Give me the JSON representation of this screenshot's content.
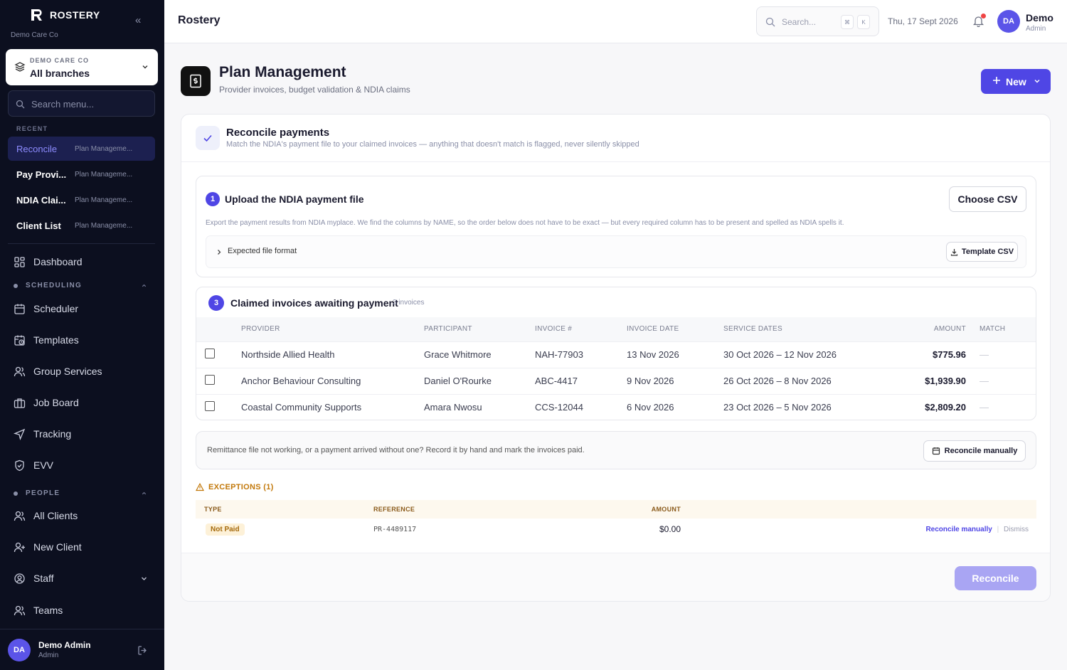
{
  "sidebar": {
    "brand": "ROSTERY",
    "org": "Demo Care Co",
    "branch_small": "DEMO CARE CO",
    "branch_big": "All branches",
    "search_placeholder": "Search menu...",
    "recent_label": "RECENT",
    "recent": [
      {
        "title": "Reconcile",
        "sub": "Plan Manageme..."
      },
      {
        "title": "Pay Provi...",
        "sub": "Plan Manageme..."
      },
      {
        "title": "NDIA Clai...",
        "sub": "Plan Manageme..."
      },
      {
        "title": "Client List",
        "sub": "Plan Manageme..."
      }
    ],
    "dashboard": "Dashboard",
    "scheduling_label": "SCHEDULING",
    "scheduling": [
      "Scheduler",
      "Templates",
      "Group Services",
      "Job Board",
      "Tracking",
      "EVV"
    ],
    "people_label": "PEOPLE",
    "people": [
      "All Clients",
      "New Client",
      "Staff",
      "Teams"
    ],
    "user_name": "Demo Admin",
    "user_role": "Admin",
    "user_initials": "DA"
  },
  "topbar": {
    "title": "Rostery",
    "search_placeholder": "Search...",
    "kbd1": "⌘",
    "kbd2": "K",
    "date": "Thu, 17 Sept 2026",
    "user_initials": "DA",
    "user_name": "Demo",
    "user_role": "Admin"
  },
  "page": {
    "title": "Plan Management",
    "subtitle": "Provider invoices, budget validation & NDIA claims",
    "new_label": "New"
  },
  "reconcile": {
    "title": "Reconcile payments",
    "subtitle": "Match the NDIA's payment file to your claimed invoices — anything that doesn't match is flagged, never silently skipped"
  },
  "upload": {
    "step": "1",
    "title": "Upload the NDIA payment file",
    "choose_label": "Choose CSV",
    "description": "Export the payment results from NDIA myplace. We find the columns by NAME, so the order below does not have to be exact — but every required column has to be present and spelled as NDIA spells it.",
    "expected_label": "Expected file format",
    "template_label": "Template CSV"
  },
  "claimed": {
    "step": "3",
    "title": "Claimed invoices awaiting payment",
    "count": "3 invoices",
    "headers": [
      "PROVIDER",
      "PARTICIPANT",
      "INVOICE #",
      "INVOICE DATE",
      "SERVICE DATES",
      "AMOUNT",
      "MATCH"
    ],
    "rows": [
      {
        "provider": "Northside Allied Health",
        "participant": "Grace Whitmore",
        "invoice": "NAH-77903",
        "date": "13 Nov 2026",
        "service": "30 Oct 2026 – 12 Nov 2026",
        "amount": "$775.96",
        "match": "—"
      },
      {
        "provider": "Anchor Behaviour Consulting",
        "participant": "Daniel O'Rourke",
        "invoice": "ABC-4417",
        "date": "9 Nov 2026",
        "service": "26 Oct 2026 – 8 Nov 2026",
        "amount": "$1,939.90",
        "match": "—"
      },
      {
        "provider": "Coastal Community Supports",
        "participant": "Amara Nwosu",
        "invoice": "CCS-12044",
        "date": "6 Nov 2026",
        "service": "23 Oct 2026 – 5 Nov 2026",
        "amount": "$2,809.20",
        "match": "—"
      }
    ]
  },
  "manual": {
    "text": "Remittance file not working, or a payment arrived without one? Record it by hand and mark the invoices paid.",
    "button": "Reconcile manually"
  },
  "exceptions": {
    "title": "EXCEPTIONS (1)",
    "headers": [
      "TYPE",
      "REFERENCE",
      "AMOUNT"
    ],
    "rows": [
      {
        "type": "Not Paid",
        "reference": "PR-4489117",
        "amount": "$0.00",
        "action": "Reconcile manually",
        "dismiss": "Dismiss"
      }
    ]
  },
  "footer": {
    "reconcile_label": "Reconcile"
  },
  "colors": {
    "accent": "#4f46e5",
    "sidebar": "#0c0f1f",
    "warning": "#c2780a"
  }
}
